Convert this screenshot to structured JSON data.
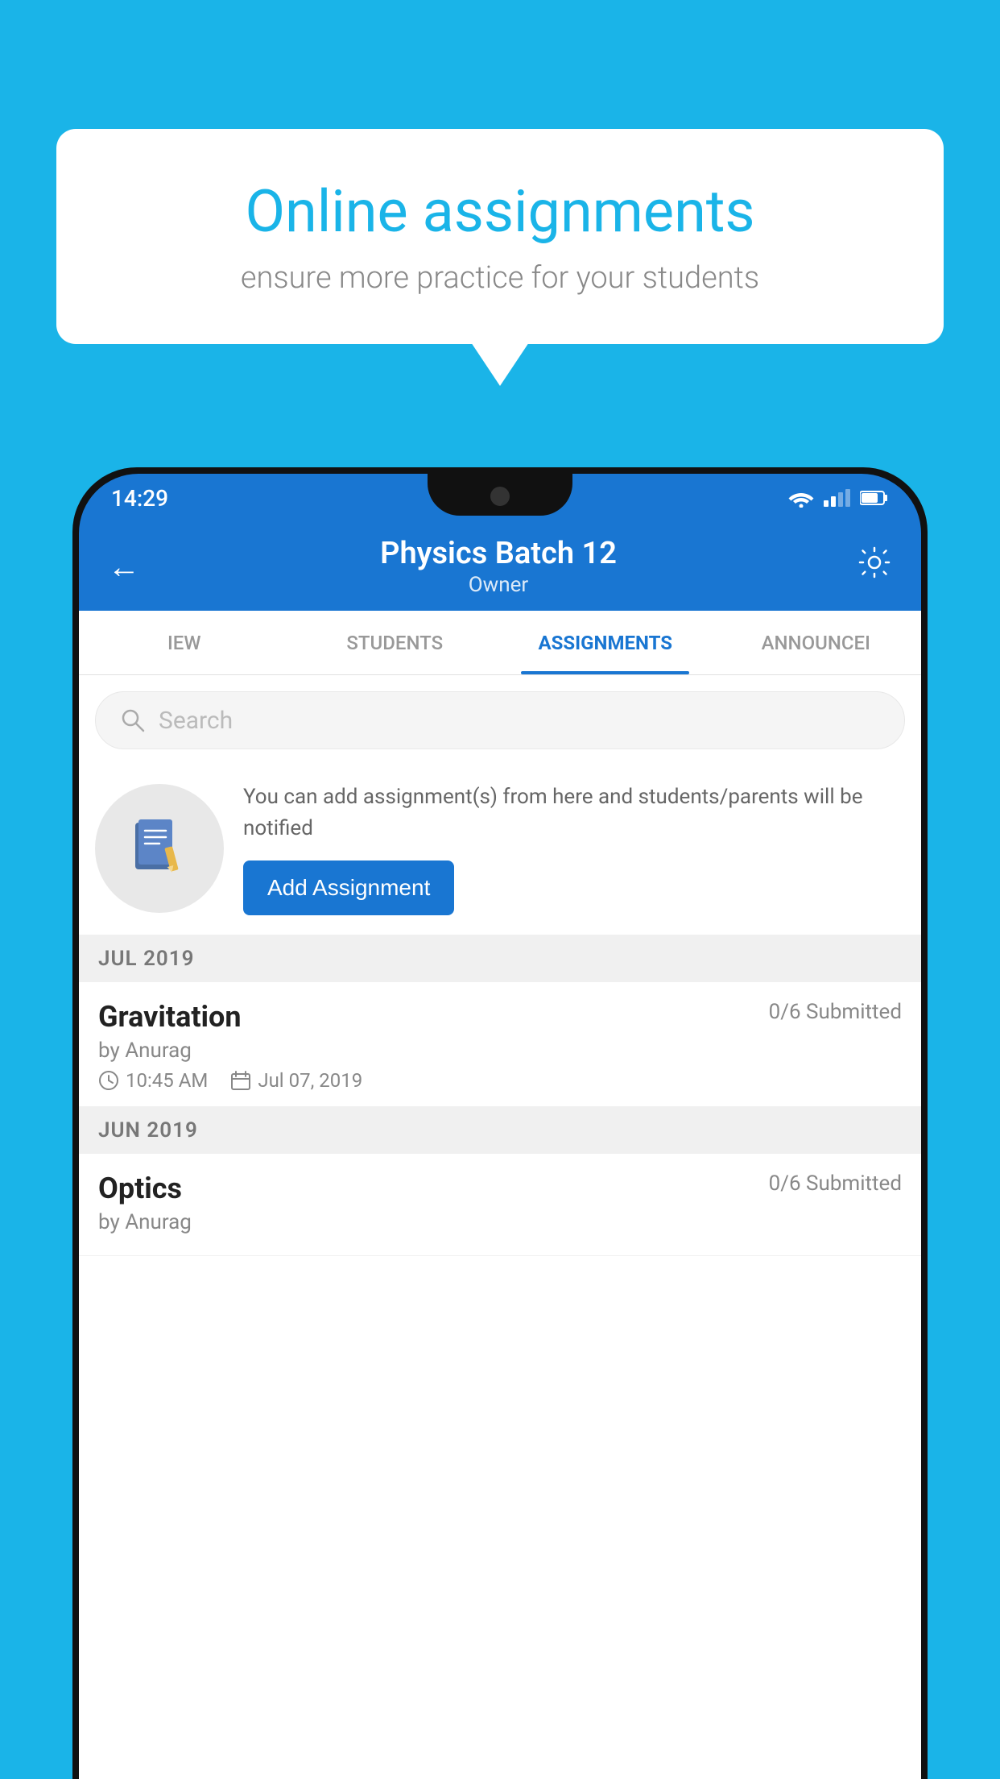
{
  "background_color": "#1ab4e8",
  "bubble": {
    "title": "Online assignments",
    "subtitle": "ensure more practice for your students"
  },
  "status_bar": {
    "time": "14:29"
  },
  "header": {
    "title": "Physics Batch 12",
    "subtitle": "Owner"
  },
  "tabs": [
    {
      "label": "IEW",
      "active": false
    },
    {
      "label": "STUDENTS",
      "active": false
    },
    {
      "label": "ASSIGNMENTS",
      "active": true
    },
    {
      "label": "ANNOUNCEI",
      "active": false
    }
  ],
  "search": {
    "placeholder": "Search"
  },
  "promo": {
    "description": "You can add assignment(s) from here and students/parents will be notified",
    "button_label": "Add Assignment"
  },
  "sections": [
    {
      "label": "JUL 2019",
      "assignments": [
        {
          "title": "Gravitation",
          "submitted": "0/6 Submitted",
          "by": "by Anurag",
          "time": "10:45 AM",
          "date": "Jul 07, 2019"
        }
      ]
    },
    {
      "label": "JUN 2019",
      "assignments": [
        {
          "title": "Optics",
          "submitted": "0/6 Submitted",
          "by": "by Anurag",
          "time": "",
          "date": ""
        }
      ]
    }
  ]
}
